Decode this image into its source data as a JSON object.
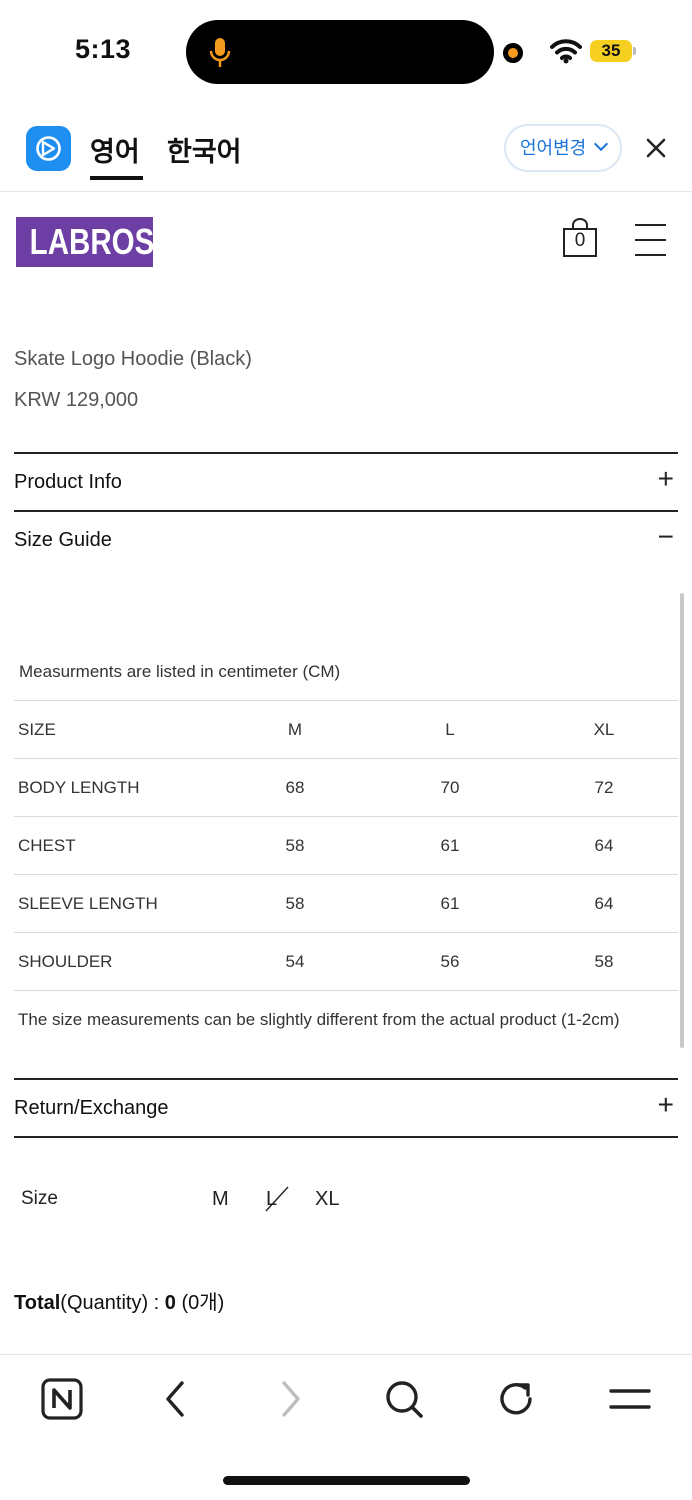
{
  "status_bar": {
    "time": "5:13",
    "battery": "35"
  },
  "translator": {
    "tab_english": "영어",
    "tab_korean": "한국어",
    "change_language": "언어변경"
  },
  "site": {
    "logo_text": "LABROS",
    "cart_count": "0"
  },
  "product": {
    "name": "Skate Logo Hoodie (Black)",
    "price": "KRW 129,000"
  },
  "sections": {
    "product_info": {
      "title": "Product Info",
      "toggle": "+"
    },
    "size_guide": {
      "title": "Size Guide",
      "toggle": "−"
    },
    "return_exchange": {
      "title": "Return/Exchange",
      "toggle": "+"
    }
  },
  "size_guide": {
    "note": "Measurments are listed in centimeter (CM)",
    "header": [
      "SIZE",
      "M",
      "L",
      "XL"
    ],
    "rows": [
      [
        "BODY LENGTH",
        "68",
        "70",
        "72"
      ],
      [
        "CHEST",
        "58",
        "61",
        "64"
      ],
      [
        "SLEEVE LENGTH",
        "58",
        "61",
        "64"
      ],
      [
        "SHOULDER",
        "54",
        "56",
        "58"
      ]
    ],
    "footnote": "The size measurements can be slightly different from the actual product (1-2cm)"
  },
  "options": {
    "label": "Size",
    "sizes": [
      "M",
      "L",
      "XL"
    ],
    "sold_out": [
      "L"
    ]
  },
  "total": {
    "label_bold": "Total",
    "label_rest": "(Quantity) : ",
    "quantity": "0",
    "korean": " (0개)"
  },
  "colors": {
    "brand": "#6d3fa5",
    "translator_blue": "#1e8ff0",
    "battery": "#f5d020"
  },
  "toolbar": {
    "icons": [
      "naver-icon",
      "back-icon",
      "forward-icon",
      "search-icon",
      "refresh-icon",
      "menu-icon"
    ]
  }
}
